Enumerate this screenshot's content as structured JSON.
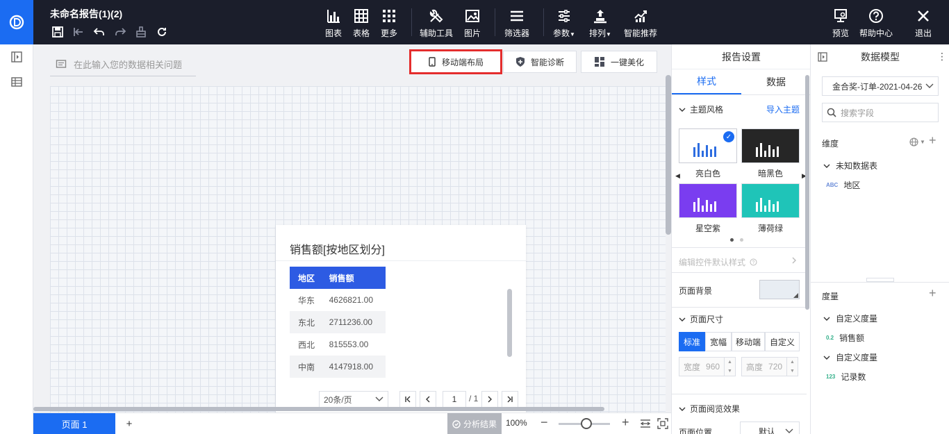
{
  "app": {
    "report_title": "未命名报告(1)(2)"
  },
  "toolbar": {
    "chart": "图表",
    "table": "表格",
    "more": "更多",
    "aux_tools": "辅助工具",
    "image": "图片",
    "filter": "筛选器",
    "params": "参数",
    "sort": "排列",
    "smart_recommend": "智能推荐",
    "preview": "预览",
    "help": "帮助中心",
    "exit": "退出"
  },
  "canvas": {
    "ask_placeholder": "在此输入您的数据相关问题",
    "mobile_layout": "移动端布局",
    "smart_diagnose": "智能诊断",
    "beautify": "一键美化"
  },
  "widget": {
    "title": "销售额[按地区划分]",
    "columns": [
      "地区",
      "销售额"
    ],
    "rows": [
      [
        "华东",
        "4626821.00"
      ],
      [
        "东北",
        "2711236.00"
      ],
      [
        "西北",
        "815553.00"
      ],
      [
        "中南",
        "4147918.00"
      ]
    ],
    "page_size": "20条/页",
    "current_page": "1",
    "total_pages": "/ 1"
  },
  "bottom": {
    "page_tab": "页面 1",
    "add_page": "+",
    "analysis": "分析结果",
    "zoom": "100%",
    "zoom_minus": "−",
    "zoom_plus": "+"
  },
  "settings": {
    "header": "报告设置",
    "tab_style": "样式",
    "tab_data": "数据",
    "theme_section": "主题风格",
    "import_theme": "导入主题",
    "themes": [
      {
        "name": "亮白色",
        "bg": "#ffffff",
        "bar": "#2d6de0",
        "selected": true
      },
      {
        "name": "暗黑色",
        "bg": "#262626",
        "bar": "#ffffff",
        "selected": false
      },
      {
        "name": "星空紫",
        "bg": "#7a3df0",
        "bar": "#ffffff",
        "selected": false
      },
      {
        "name": "薄荷绿",
        "bg": "#1fc4b8",
        "bar": "#ffffff",
        "selected": false
      }
    ],
    "edit_default_style": "编辑控件默认样式",
    "page_background": "页面背景",
    "page_size_section": "页面尺寸",
    "size_options": [
      "标准",
      "宽幅",
      "移动端",
      "自定义"
    ],
    "width_label": "宽度",
    "width_value": "960",
    "height_label": "高度",
    "height_value": "720",
    "browse_effect": "页面阅览效果",
    "page_position": "页面位置",
    "page_position_value": "默认"
  },
  "model": {
    "header": "数据模型",
    "dataset": "金合奖-订单-2021-04-26",
    "search_placeholder": "搜索字段",
    "dimension_label": "维度",
    "unknown_table": "未知数据表",
    "dim_type": "ABC",
    "dim_field": "地区",
    "measure_label": "度量",
    "custom_measure_1": "自定义度量",
    "m1_type": "0.2",
    "m1_field": "销售额",
    "custom_measure_2": "自定义度量",
    "m2_type": "123",
    "m2_field": "记录数"
  },
  "colors": {
    "accent": "#1b6cf2",
    "topbar": "#1b1e2b",
    "table_header": "#2d5be3",
    "highlight": "#e42d2d"
  }
}
